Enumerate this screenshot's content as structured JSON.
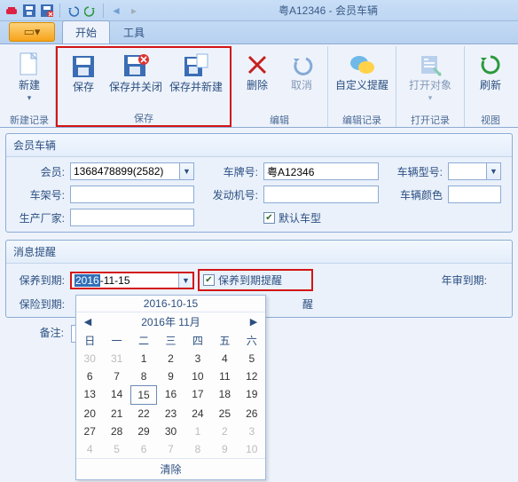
{
  "title": "粤A12346 - 会员车辆",
  "tabs": {
    "file_icon": "▭",
    "start": "开始",
    "tools": "工具"
  },
  "ribbon": {
    "newrec": {
      "new": "新建",
      "title": "新建记录"
    },
    "save": {
      "save": "保存",
      "saveclose": "保存并关闭",
      "savenew": "保存并新建",
      "title": "保存"
    },
    "edit": {
      "delete": "删除",
      "cancel": "取消",
      "title": "编辑"
    },
    "editrec": {
      "custom": "自定义提醒",
      "title": "编辑记录"
    },
    "openrec": {
      "open": "打开对象",
      "title": "打开记录"
    },
    "view": {
      "refresh": "刷新",
      "title": "视图"
    }
  },
  "vehicle": {
    "title": "会员车辆",
    "member_label": "会员:",
    "member_value": "1368478899(2582)",
    "plate_label": "车牌号:",
    "plate_value": "粤A12346",
    "model_label": "车辆型号:",
    "vin_label": "车架号:",
    "engine_label": "发动机号:",
    "color_label": "车辆颜色",
    "mfr_label": "生产厂家:",
    "default_label": "默认车型"
  },
  "reminder": {
    "title": "消息提醒",
    "maint_label": "保养到期:",
    "maint_sel": "2016",
    "maint_rest": "-11-15",
    "maint_chk": "保养到期提醒",
    "annual_label": "年审到期:",
    "ins_label": "保险到期:",
    "ins_chk_suffix": "醒",
    "remark_label": "备注:"
  },
  "dp": {
    "top": "2016-10-15",
    "month": "2016年 11月",
    "dh": [
      "日",
      "一",
      "二",
      "三",
      "四",
      "五",
      "六"
    ],
    "rows": [
      [
        {
          "d": "30",
          "om": 1
        },
        {
          "d": "31",
          "om": 1
        },
        {
          "d": "1"
        },
        {
          "d": "2"
        },
        {
          "d": "3"
        },
        {
          "d": "4"
        },
        {
          "d": "5"
        }
      ],
      [
        {
          "d": "6"
        },
        {
          "d": "7"
        },
        {
          "d": "8"
        },
        {
          "d": "9"
        },
        {
          "d": "10"
        },
        {
          "d": "11"
        },
        {
          "d": "12"
        }
      ],
      [
        {
          "d": "13"
        },
        {
          "d": "14"
        },
        {
          "d": "15",
          "t": 1
        },
        {
          "d": "16"
        },
        {
          "d": "17"
        },
        {
          "d": "18"
        },
        {
          "d": "19"
        }
      ],
      [
        {
          "d": "20"
        },
        {
          "d": "21"
        },
        {
          "d": "22"
        },
        {
          "d": "23"
        },
        {
          "d": "24"
        },
        {
          "d": "25"
        },
        {
          "d": "26"
        }
      ],
      [
        {
          "d": "27"
        },
        {
          "d": "28"
        },
        {
          "d": "29"
        },
        {
          "d": "30"
        },
        {
          "d": "1",
          "om": 1
        },
        {
          "d": "2",
          "om": 1
        },
        {
          "d": "3",
          "om": 1
        }
      ],
      [
        {
          "d": "4",
          "om": 1
        },
        {
          "d": "5",
          "om": 1
        },
        {
          "d": "6",
          "om": 1
        },
        {
          "d": "7",
          "om": 1
        },
        {
          "d": "8",
          "om": 1
        },
        {
          "d": "9",
          "om": 1
        },
        {
          "d": "10",
          "om": 1
        }
      ]
    ],
    "clear": "清除"
  }
}
